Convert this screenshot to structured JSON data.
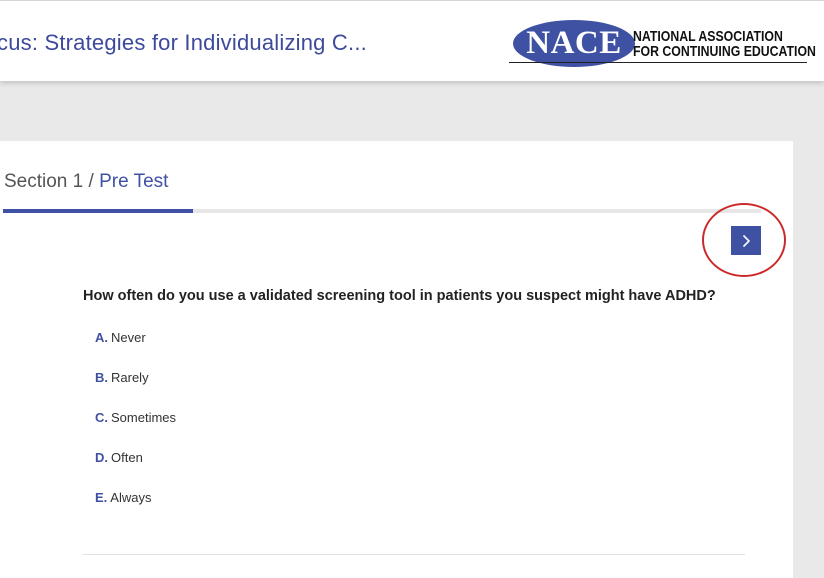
{
  "header": {
    "course_title": "cus: Strategies for Individualizing C...",
    "logo": {
      "mark": "NACE",
      "line1": "NATIONAL ASSOCIATION",
      "line2": "FOR CONTINUING EDUCATION"
    }
  },
  "breadcrumb": {
    "section": "Section 1",
    "separator": " / ",
    "current": "Pre Test"
  },
  "progress": {
    "fraction": 0.25
  },
  "next_button": {
    "icon": "chevron-right-icon",
    "highlight_color": "#cc2a2a"
  },
  "question": {
    "text": "How often do you use a validated screening tool in patients you suspect might have ADHD?",
    "options": [
      {
        "letter": "A.",
        "label": "Never"
      },
      {
        "letter": "B.",
        "label": "Rarely"
      },
      {
        "letter": "C.",
        "label": "Sometimes"
      },
      {
        "letter": "D.",
        "label": "Often"
      },
      {
        "letter": "E.",
        "label": "Always"
      }
    ]
  },
  "colors": {
    "accent": "#3f51a3",
    "background": "#e9e9e9",
    "panel": "#ffffff"
  }
}
